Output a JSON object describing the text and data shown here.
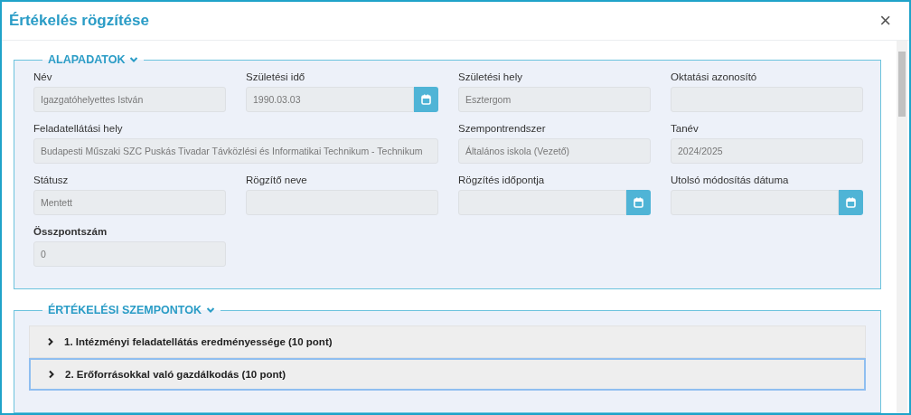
{
  "window": {
    "title": "Értékelés rögzítése",
    "close": "×"
  },
  "basic_section": {
    "title": "ALAPADATOK",
    "expanded": true,
    "fields": [
      {
        "kind": "text",
        "label": "Név",
        "value": "Igazgatóhelyettes István",
        "wide": false,
        "emphasis": false
      },
      {
        "kind": "date",
        "label": "Születési idő",
        "value": "1990.03.03",
        "wide": false,
        "emphasis": false
      },
      {
        "kind": "text",
        "label": "Születési hely",
        "value": "Esztergom",
        "wide": false,
        "emphasis": false
      },
      {
        "kind": "text",
        "label": "Oktatási azonosító",
        "wide": false,
        "emphasis": false
      },
      {
        "kind": "text",
        "label": "Feladatellátási hely",
        "value": "Budapesti Műszaki SZC Puskás Tivadar Távközlési és Informatikai Technikum - Technikum",
        "wide": true,
        "emphasis": false
      },
      {
        "kind": "text",
        "label": "Szempontrendszer",
        "value": "Általános iskola (Vezető)",
        "wide": false,
        "emphasis": false
      },
      {
        "kind": "text",
        "label": "Tanév",
        "value": "2024/2025",
        "wide": false,
        "emphasis": false
      },
      {
        "kind": "text",
        "label": "Státusz",
        "value": "Mentett",
        "wide": false,
        "emphasis": false
      },
      {
        "kind": "text",
        "label": "Rögzítő neve",
        "wide": false,
        "emphasis": false
      },
      {
        "kind": "date",
        "label": "Rögzítés időpontja",
        "wide": false,
        "emphasis": false
      },
      {
        "kind": "date",
        "label": "Utolsó módosítás dátuma",
        "wide": false,
        "emphasis": false
      },
      {
        "kind": "text",
        "label": "Összpontszám",
        "value": "0",
        "wide": false,
        "emphasis": true
      }
    ]
  },
  "criteria_section": {
    "title": "ÉRTÉKELÉSI SZEMPONTOK",
    "expanded": true,
    "items": [
      {
        "label": "1. Intézményi feladatellátás eredményessége (10 pont)",
        "expanded": false,
        "focused": false
      },
      {
        "label": "2. Erőforrásokkal való gazdálkodás (10 pont)",
        "expanded": false,
        "focused": true
      }
    ]
  }
}
